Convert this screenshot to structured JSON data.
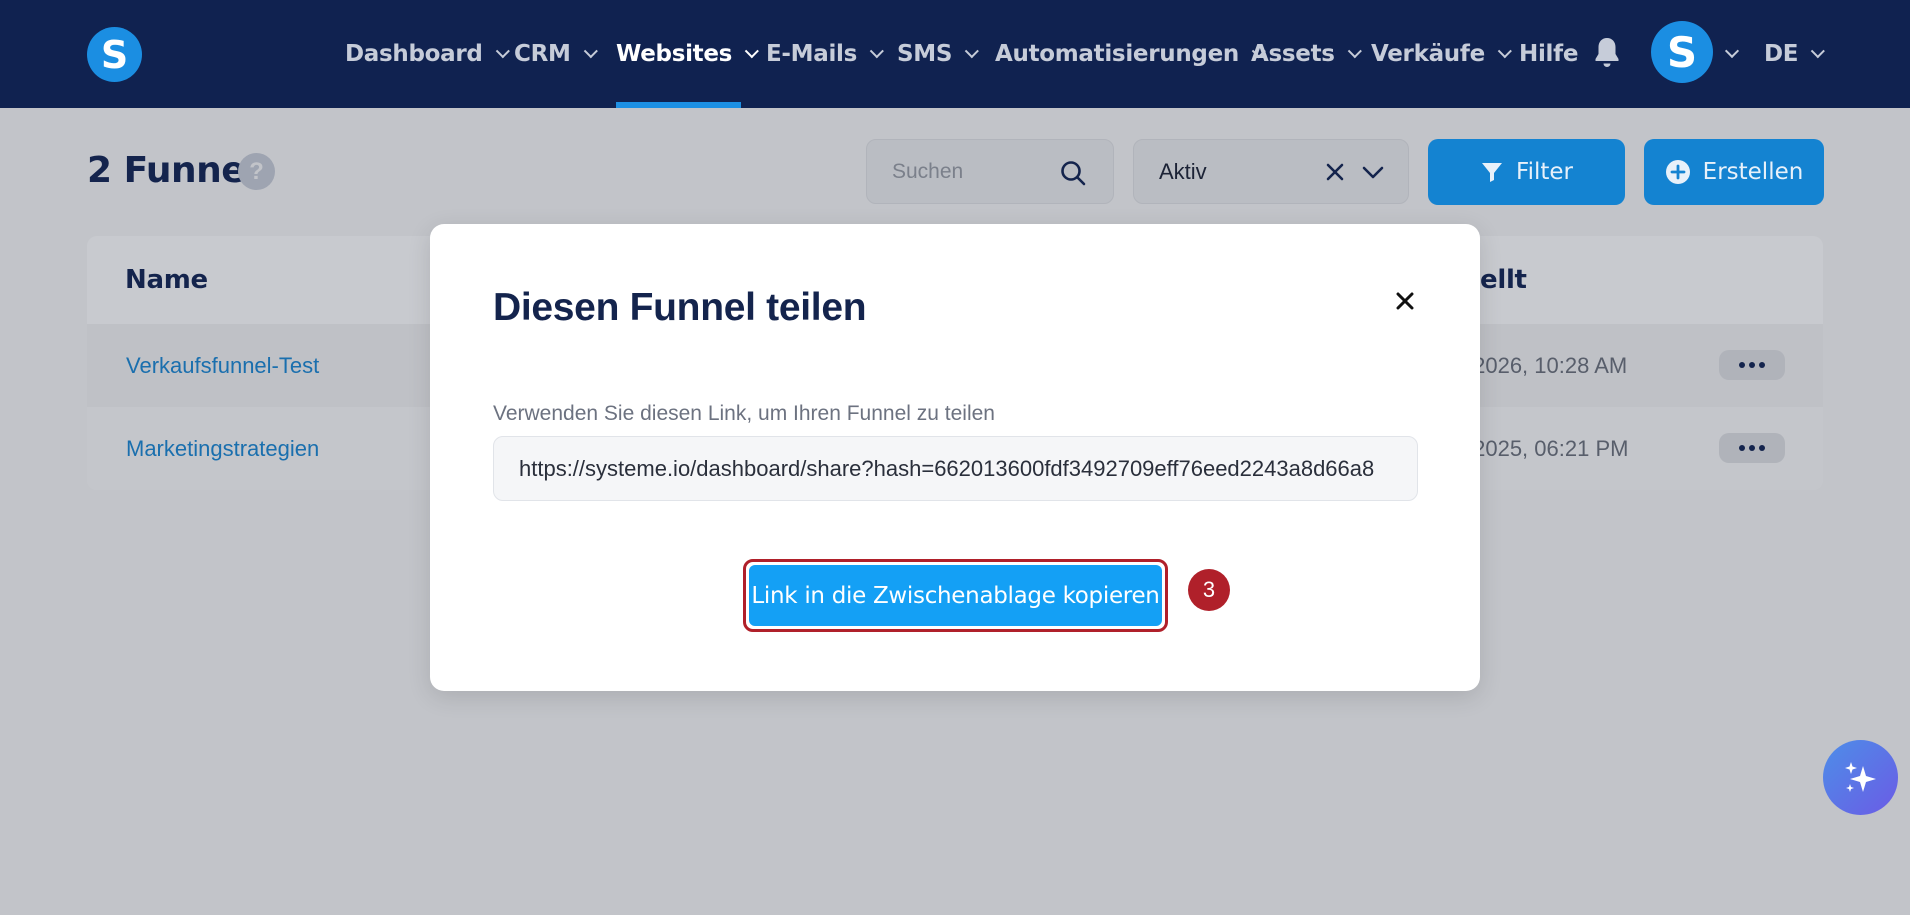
{
  "nav": {
    "logo": "S",
    "items": [
      {
        "label": "Dashboard",
        "has_chevron": true,
        "active": false
      },
      {
        "label": "CRM",
        "has_chevron": true,
        "active": false
      },
      {
        "label": "Websites",
        "has_chevron": true,
        "active": true
      },
      {
        "label": "E-Mails",
        "has_chevron": true,
        "active": false
      },
      {
        "label": "SMS",
        "has_chevron": true,
        "active": false
      },
      {
        "label": "Automatisierungen",
        "has_chevron": true,
        "active": false
      },
      {
        "label": "Assets",
        "has_chevron": true,
        "active": false
      },
      {
        "label": "Verkäufe",
        "has_chevron": true,
        "active": false
      },
      {
        "label": "Hilfe",
        "has_chevron": false,
        "active": false
      }
    ],
    "avatar": "S",
    "language": "DE",
    "colors": {
      "background": "#102250",
      "accent": "#1d90e4"
    }
  },
  "page": {
    "title": "2 Funnel",
    "help_icon": "?",
    "search": {
      "placeholder": "Suchen"
    },
    "status_filter": {
      "value": "Aktiv"
    },
    "filter_button": "Filter",
    "create_button": "Erstellen"
  },
  "table": {
    "headers": {
      "name": "Name",
      "created": "ellt"
    },
    "rows": [
      {
        "name": "Verkaufsfunnel-Test",
        "created": "/2026, 10:28 AM"
      },
      {
        "name": "Marketingstrategien",
        "created": "/2025, 06:21 PM"
      }
    ]
  },
  "modal": {
    "title": "Diesen Funnel teilen",
    "label": "Verwenden Sie diesen Link, um Ihren Funnel zu teilen",
    "link": "https://systeme.io/dashboard/share?hash=662013600fdf3492709eff76eed2243a8d66a8",
    "copy_button": "Link in die Zwischenablage kopieren",
    "step_number": "3"
  },
  "icons": {
    "bell": "bell-icon",
    "search": "search-icon",
    "close": "close-icon",
    "filter": "filter-icon",
    "plus": "plus-circle-icon",
    "ai": "sparkles-icon"
  }
}
